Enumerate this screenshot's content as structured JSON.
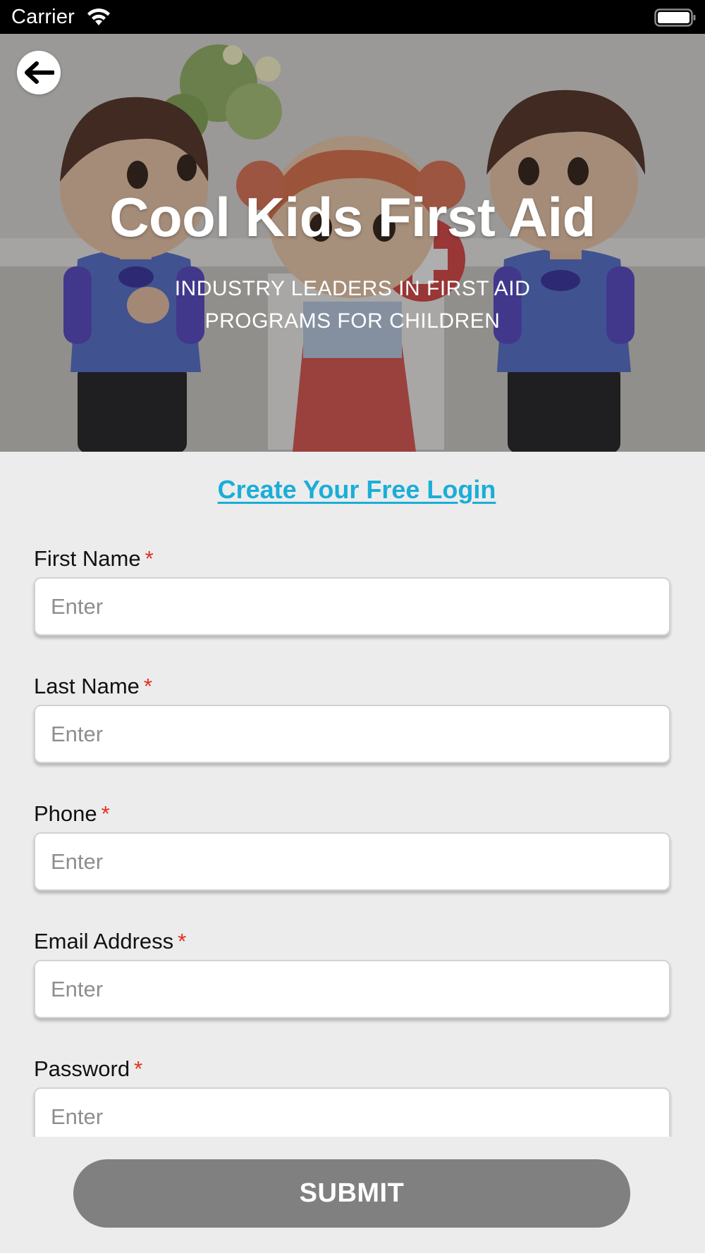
{
  "status_bar": {
    "carrier": "Carrier",
    "wifi_icon": "wifi-icon",
    "battery_icon": "battery-full-icon"
  },
  "hero": {
    "back_icon": "arrow-left-icon",
    "title": "Cool Kids First Aid",
    "subtitle": "INDUSTRY LEADERS IN FIRST AID PROGRAMS FOR CHILDREN"
  },
  "form": {
    "heading": "Create Your Free Login",
    "required_marker": "*",
    "fields": [
      {
        "label": "First Name",
        "placeholder": "Enter",
        "value": ""
      },
      {
        "label": "Last Name",
        "placeholder": "Enter",
        "value": ""
      },
      {
        "label": "Phone",
        "placeholder": "Enter",
        "value": ""
      },
      {
        "label": "Email Address",
        "placeholder": "Enter",
        "value": ""
      },
      {
        "label": "Password",
        "placeholder": "Enter",
        "value": ""
      }
    ],
    "submit_label": "SUBMIT"
  },
  "colors": {
    "link": "#1aaed8",
    "required": "#e0301e",
    "submit_bg": "#808080",
    "background": "#ececec"
  }
}
